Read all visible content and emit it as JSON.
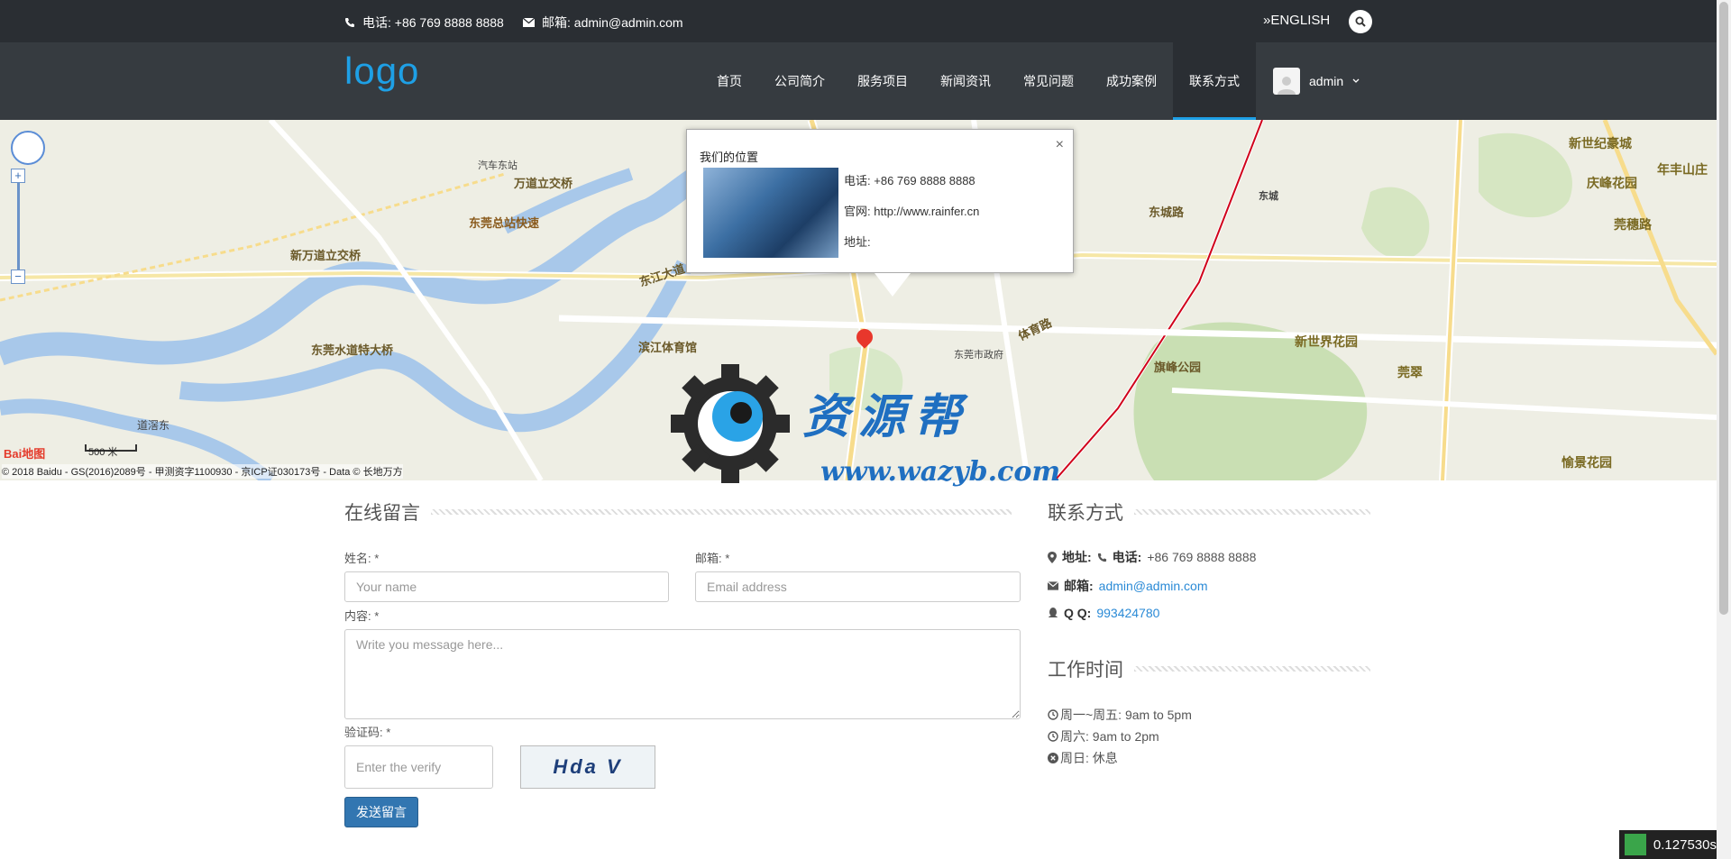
{
  "topbar": {
    "phone": "电话: +86 769 8888 8888",
    "email": "邮箱: admin@admin.com",
    "lang": "»ENGLISH"
  },
  "nav": {
    "logo": "logo",
    "items": [
      "首页",
      "公司简介",
      "服务项目",
      "新闻资讯",
      "常见问题",
      "成功案例",
      "联系方式"
    ],
    "active_index": 6,
    "user": "admin"
  },
  "map": {
    "labels": [
      "东莞水道特大桥",
      "东江大道",
      "滨江体育馆",
      "东城路",
      "旗峰公园",
      "万道立交桥",
      "东莞总站快速",
      "新万道立交桥",
      "东城",
      "新世纪豪城",
      "年丰山庄",
      "新世界花园",
      "体育路",
      "汽车东站",
      "东莞市政府",
      "庆峰花园",
      "莞穗路",
      "愉景花园",
      "道滘东",
      "莞翠"
    ],
    "scale": "500 米",
    "baidu": "Bai地图",
    "copyright": "© 2018 Baidu - GS(2016)2089号 - 甲测资字1100930 - 京ICP证030173号 - Data © 长地万方",
    "popup": {
      "title": "我们的位置",
      "close": "×",
      "phone_label": "电话:",
      "phone": "+86 769 8888 8888",
      "site_label": "官网:",
      "site": "http://www.rainfer.cn",
      "addr_label": "地址:"
    }
  },
  "watermark": {
    "title": "资源帮",
    "url": "www.wazyb.com"
  },
  "form": {
    "title": "在线留言",
    "name_label": "姓名: *",
    "name_placeholder": "Your name",
    "email_label": "邮箱: *",
    "email_placeholder": "Email address",
    "content_label": "内容: *",
    "content_placeholder": "Write you message here...",
    "verify_label": "验证码: *",
    "verify_placeholder": "Enter the verify",
    "captcha_text": "Hda V",
    "submit": "发送留言"
  },
  "contact": {
    "title": "联系方式",
    "address_label": "地址:",
    "phone_label": "电话:",
    "phone": "+86 769 8888 8888",
    "email_label": "邮箱:",
    "email": "admin@admin.com",
    "qq_label": "Q Q:",
    "qq": "993424780"
  },
  "hours": {
    "title": "工作时间",
    "weekday": "周一~周五: 9am to 5pm",
    "saturday": "周六: 9am to 2pm",
    "sunday": "周日: 休息"
  },
  "timer": "0.127530s"
}
